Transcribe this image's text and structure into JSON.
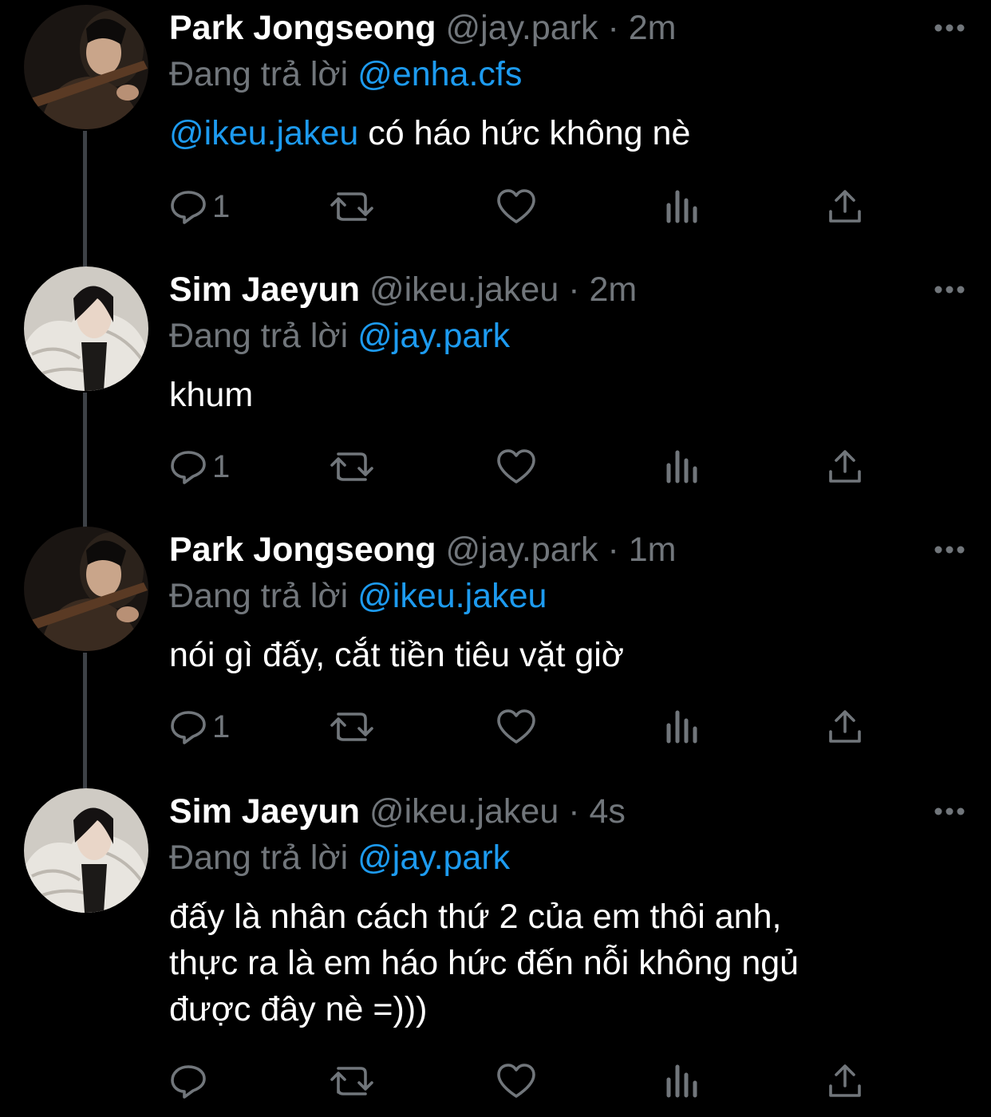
{
  "colors": {
    "background": "#000000",
    "primary_text": "#ffffff",
    "secondary_text": "#71767b",
    "link": "#1d9bf0",
    "thread_line": "#3d4146"
  },
  "tweets": [
    {
      "name": "Park Jongseong",
      "handle": "@jay.park",
      "separator": "·",
      "time": "2m",
      "reply_prefix": "Đang trả lời",
      "reply_to": "@enha.cfs",
      "mention": "@ikeu.jakeu",
      "text": "có háo hức không nè",
      "reply_count": "1",
      "avatar": "guitar-player-avatar"
    },
    {
      "name": "Sim Jaeyun",
      "handle": "@ikeu.jakeu",
      "separator": "·",
      "time": "2m",
      "reply_prefix": "Đang trả lời",
      "reply_to": "@jay.park",
      "text": "khum",
      "reply_count": "1",
      "avatar": "white-puffer-jacket-avatar"
    },
    {
      "name": "Park Jongseong",
      "handle": "@jay.park",
      "separator": "·",
      "time": "1m",
      "reply_prefix": "Đang trả lời",
      "reply_to": "@ikeu.jakeu",
      "text": "nói gì đấy, cắt tiền tiêu vặt giờ",
      "reply_count": "1",
      "avatar": "guitar-player-avatar"
    },
    {
      "name": "Sim Jaeyun",
      "handle": "@ikeu.jakeu",
      "separator": "·",
      "time": "4s",
      "reply_prefix": "Đang trả lời",
      "reply_to": "@jay.park",
      "text_lines": [
        "đấy là nhân cách thứ 2 của em thôi anh,",
        "thực ra là em háo hức đến nỗi không ngủ",
        "được đây nè =)))"
      ],
      "reply_count": "",
      "avatar": "white-puffer-jacket-avatar"
    }
  ],
  "icons": {
    "reply": "reply-icon",
    "retweet": "retweet-icon",
    "like": "heart-icon",
    "views": "views-icon",
    "share": "share-icon",
    "more": "more-options-icon"
  }
}
